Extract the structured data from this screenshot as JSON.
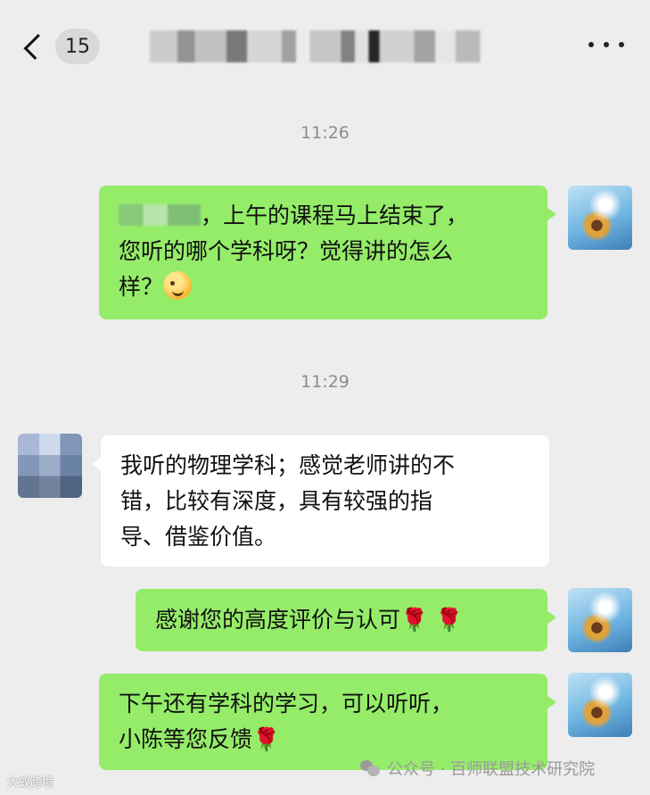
{
  "header": {
    "unread_count": "15",
    "title_redacted": true
  },
  "messages": [
    {
      "time": "11:26"
    },
    {
      "side": "out",
      "line1_suffix": "，上午的课程马上结束了，",
      "line2": "您听的哪个学科呀？觉得讲的怎么",
      "line3_prefix": "样？",
      "emoji": "wink-emoji"
    },
    {
      "time": "11:29"
    },
    {
      "side": "in",
      "line1": "我听的物理学科；感觉老师讲的不",
      "line2": "错，比较有深度，具有较强的指",
      "line3": "导、借鉴价值。"
    },
    {
      "side": "out",
      "text": "感谢您的高度评价与认可",
      "roses": "🌹 🌹"
    },
    {
      "side": "out",
      "line1": "下午还有学科的学习，可以听听，",
      "line2": "小陈等您反馈",
      "rose": "🌹"
    }
  ],
  "watermarks": {
    "left": "大蚁跨境",
    "right": "公众号 · 百师联盟技术研究院"
  },
  "colors": {
    "background": "#ededed",
    "outgoing_bubble": "#95ec69",
    "incoming_bubble": "#ffffff"
  }
}
